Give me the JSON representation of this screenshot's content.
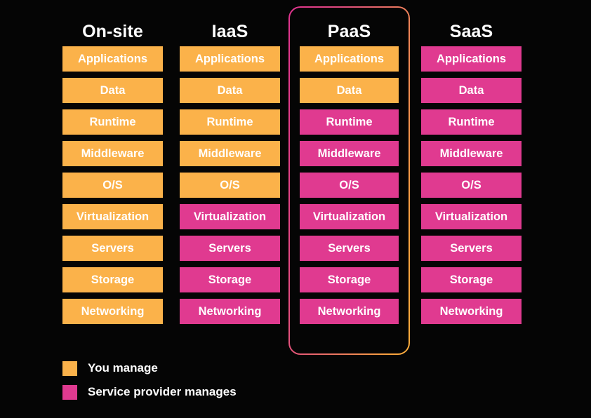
{
  "diagram": {
    "background_color": "#050505",
    "colors": {
      "you_manage": "#fbb24a",
      "provider_manages": "#e03a90",
      "text": "#ffffff",
      "highlight_border_start": "#e0338f",
      "highlight_border_end": "#f9ab3c"
    },
    "layer_names": [
      "Applications",
      "Data",
      "Runtime",
      "Middleware",
      "O/S",
      "Virtualization",
      "Servers",
      "Storage",
      "Networking"
    ],
    "columns": [
      {
        "title": "On-site",
        "highlighted": false,
        "layers": [
          {
            "label": "Applications",
            "managed_by": "you"
          },
          {
            "label": "Data",
            "managed_by": "you"
          },
          {
            "label": "Runtime",
            "managed_by": "you"
          },
          {
            "label": "Middleware",
            "managed_by": "you"
          },
          {
            "label": "O/S",
            "managed_by": "you"
          },
          {
            "label": "Virtualization",
            "managed_by": "you"
          },
          {
            "label": "Servers",
            "managed_by": "you"
          },
          {
            "label": "Storage",
            "managed_by": "you"
          },
          {
            "label": "Networking",
            "managed_by": "you"
          }
        ]
      },
      {
        "title": "IaaS",
        "highlighted": false,
        "layers": [
          {
            "label": "Applications",
            "managed_by": "you"
          },
          {
            "label": "Data",
            "managed_by": "you"
          },
          {
            "label": "Runtime",
            "managed_by": "you"
          },
          {
            "label": "Middleware",
            "managed_by": "you"
          },
          {
            "label": "O/S",
            "managed_by": "you"
          },
          {
            "label": "Virtualization",
            "managed_by": "provider"
          },
          {
            "label": "Servers",
            "managed_by": "provider"
          },
          {
            "label": "Storage",
            "managed_by": "provider"
          },
          {
            "label": "Networking",
            "managed_by": "provider"
          }
        ]
      },
      {
        "title": "PaaS",
        "highlighted": true,
        "layers": [
          {
            "label": "Applications",
            "managed_by": "you"
          },
          {
            "label": "Data",
            "managed_by": "you"
          },
          {
            "label": "Runtime",
            "managed_by": "provider"
          },
          {
            "label": "Middleware",
            "managed_by": "provider"
          },
          {
            "label": "O/S",
            "managed_by": "provider"
          },
          {
            "label": "Virtualization",
            "managed_by": "provider"
          },
          {
            "label": "Servers",
            "managed_by": "provider"
          },
          {
            "label": "Storage",
            "managed_by": "provider"
          },
          {
            "label": "Networking",
            "managed_by": "provider"
          }
        ]
      },
      {
        "title": "SaaS",
        "highlighted": false,
        "layers": [
          {
            "label": "Applications",
            "managed_by": "provider"
          },
          {
            "label": "Data",
            "managed_by": "provider"
          },
          {
            "label": "Runtime",
            "managed_by": "provider"
          },
          {
            "label": "Middleware",
            "managed_by": "provider"
          },
          {
            "label": "O/S",
            "managed_by": "provider"
          },
          {
            "label": "Virtualization",
            "managed_by": "provider"
          },
          {
            "label": "Servers",
            "managed_by": "provider"
          },
          {
            "label": "Storage",
            "managed_by": "provider"
          },
          {
            "label": "Networking",
            "managed_by": "provider"
          }
        ]
      }
    ],
    "legend": [
      {
        "key": "you",
        "label": "You manage"
      },
      {
        "key": "provider",
        "label": "Service provider manages"
      }
    ]
  }
}
